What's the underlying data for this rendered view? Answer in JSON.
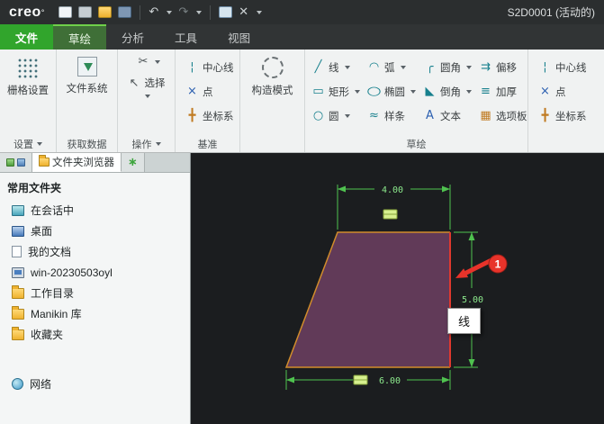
{
  "title_bar": {
    "logo": "creo",
    "logo_mark": "°",
    "document_title": "S2D0001 (活动的)"
  },
  "glyphs": {
    "undo": "↶",
    "redo": "↷",
    "close": "✕",
    "cut": "✂",
    "select": "↖",
    "star": "∗",
    "line": "╱",
    "rectangle": "▭",
    "circle": "○",
    "arc": "◠",
    "ellipse": "○",
    "spline": "≈",
    "fillet": "╭",
    "chamfer": "◣",
    "text": "A",
    "offset": "⇉",
    "thicken": "≡",
    "palette": "▦",
    "centerline": "¦",
    "point": "×",
    "csys": "╋"
  },
  "tabs": [
    {
      "label": "文件"
    },
    {
      "label": "草绘"
    },
    {
      "label": "分析"
    },
    {
      "label": "工具"
    },
    {
      "label": "视图"
    }
  ],
  "ribbon": {
    "settings": {
      "button": "栅格设置",
      "footer": "设置"
    },
    "get_data": {
      "button": "文件系统",
      "footer": "获取数据"
    },
    "operations": {
      "select": "选择",
      "footer": "操作"
    },
    "datum": {
      "items": [
        {
          "label": "中心线"
        },
        {
          "label": "点"
        },
        {
          "label": "坐标系"
        }
      ],
      "footer": "基准"
    },
    "construction": {
      "button": "构造模式"
    },
    "sketch": {
      "footer": "草绘",
      "columns": [
        [
          {
            "label": "线"
          },
          {
            "label": "矩形"
          },
          {
            "label": "圆"
          }
        ],
        [
          {
            "label": "弧"
          },
          {
            "label": "椭圆"
          },
          {
            "label": "样条"
          }
        ],
        [
          {
            "label": "圆角"
          },
          {
            "label": "倒角"
          },
          {
            "label": "文本"
          }
        ],
        [
          {
            "label": "偏移"
          },
          {
            "label": "加厚"
          },
          {
            "label": "选项板"
          }
        ],
        [
          {
            "label": "中心线"
          },
          {
            "label": "点"
          },
          {
            "label": "坐标系"
          }
        ]
      ]
    }
  },
  "sidebar": {
    "folder_browser_tab": "文件夹浏览器",
    "header": "常用文件夹",
    "items": [
      {
        "label": "在会话中"
      },
      {
        "label": "桌面"
      },
      {
        "label": "我的文档"
      },
      {
        "label": "win-20230503oyl"
      },
      {
        "label": "工作目录"
      },
      {
        "label": "Manikin 库"
      },
      {
        "label": "收藏夹"
      }
    ],
    "network": "网络"
  },
  "canvas": {
    "dimensions": {
      "top": "4.00",
      "right": "5.00",
      "bottom": "6.00"
    },
    "tooltip": "线",
    "callout_badge": "1",
    "colors": {
      "background": "#1b1d1f",
      "shape_fill": "#613a58",
      "shape_edge": "#d18c2b",
      "selected_edge": "#e0392e",
      "dimension": "#4fc24f",
      "callout": "#e8332a"
    }
  }
}
